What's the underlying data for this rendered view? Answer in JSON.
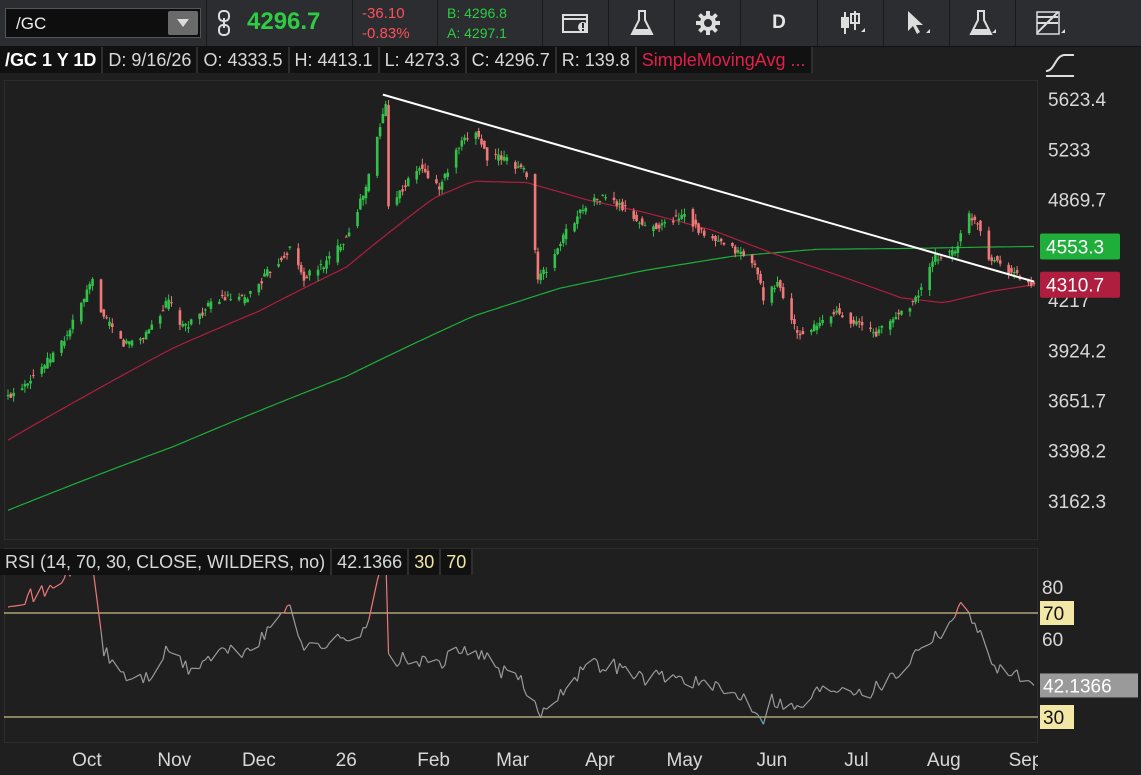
{
  "toolbar": {
    "symbol": "/GC",
    "last": "4296.7",
    "change": "-36.10",
    "change_pct": "-0.83%",
    "bid": "B: 4296.8",
    "ask": "A: 4297.1",
    "aggregation": "D"
  },
  "infobar": {
    "symbol_period": "/GC 1 Y 1D",
    "date": "D: 9/16/26",
    "open": "O: 4333.5",
    "high": "H: 4413.1",
    "low": "L: 4273.3",
    "close": "C: 4296.7",
    "range": "R: 139.8",
    "study": "SimpleMovingAvg ..."
  },
  "rsi_header": {
    "study": "RSI (14, 70, 30, CLOSE, WILDERS, no)",
    "value": "42.1366",
    "lower": "30",
    "upper": "70"
  },
  "colors": {
    "up": "#31c24a",
    "down": "#f07878",
    "sma_short": "#b01e3f",
    "sma_long": "#1fae3a",
    "trendline": "#ffffff",
    "rsi_normal": "#9a9a9a",
    "rsi_overbought": "#f07878",
    "rsi_oversold": "#2ec4d8",
    "level_line": "#f3e7a6"
  },
  "chart_data": [
    {
      "type": "candlestick",
      "ylim": [
        2990,
        5780
      ],
      "y_ticks": [
        "5623.4",
        "5233",
        "4869.7",
        "4217",
        "3924.2",
        "3651.7",
        "3398.2",
        "3162.3"
      ],
      "x_labels": [
        "Oct",
        "Nov",
        "Dec",
        "26",
        "Feb",
        "Mar",
        "Apr",
        "May",
        "Jun",
        "Jul",
        "Aug",
        "Sep"
      ],
      "price_badges": [
        {
          "value": "4553.3",
          "series": "sma_long"
        },
        {
          "value": "4310.7",
          "series": "sma_short"
        }
      ],
      "anchors": [
        [
          "2025-09-17",
          3670
        ],
        [
          "2025-09-24",
          3760
        ],
        [
          "2025-10-01",
          3860
        ],
        [
          "2025-10-08",
          4010
        ],
        [
          "2025-10-17",
          4330
        ],
        [
          "2025-10-21",
          4110
        ],
        [
          "2025-10-28",
          3960
        ],
        [
          "2025-11-04",
          4000
        ],
        [
          "2025-11-13",
          4210
        ],
        [
          "2025-11-18",
          4050
        ],
        [
          "2025-12-01",
          4230
        ],
        [
          "2025-12-10",
          4220
        ],
        [
          "2025-12-26",
          4540
        ],
        [
          "2025-12-31",
          4350
        ],
        [
          "2026-01-08",
          4450
        ],
        [
          "2026-01-15",
          4620
        ],
        [
          "2026-01-22",
          4950
        ],
        [
          "2026-01-28",
          5500
        ],
        [
          "2026-01-29",
          5580
        ],
        [
          "2026-01-30",
          4850
        ],
        [
          "2026-02-03",
          4920
        ],
        [
          "2026-02-10",
          5100
        ],
        [
          "2026-02-17",
          4950
        ],
        [
          "2026-02-24",
          5250
        ],
        [
          "2026-03-02",
          5380
        ],
        [
          "2026-03-06",
          5180
        ],
        [
          "2026-03-13",
          5160
        ],
        [
          "2026-03-20",
          5060
        ],
        [
          "2026-03-24",
          4350
        ],
        [
          "2026-03-27",
          4400
        ],
        [
          "2026-04-03",
          4650
        ],
        [
          "2026-04-10",
          4840
        ],
        [
          "2026-04-17",
          4890
        ],
        [
          "2026-04-24",
          4800
        ],
        [
          "2026-05-01",
          4680
        ],
        [
          "2026-05-08",
          4700
        ],
        [
          "2026-05-15",
          4780
        ],
        [
          "2026-05-22",
          4620
        ],
        [
          "2026-05-29",
          4560
        ],
        [
          "2026-06-05",
          4500
        ],
        [
          "2026-06-10",
          4400
        ],
        [
          "2026-06-12",
          4200
        ],
        [
          "2026-06-17",
          4330
        ],
        [
          "2026-06-24",
          4010
        ],
        [
          "2026-07-01",
          4060
        ],
        [
          "2026-07-08",
          4150
        ],
        [
          "2026-07-15",
          4080
        ],
        [
          "2026-07-22",
          4020
        ],
        [
          "2026-07-29",
          4120
        ],
        [
          "2026-08-05",
          4220
        ],
        [
          "2026-08-12",
          4480
        ],
        [
          "2026-08-19",
          4530
        ],
        [
          "2026-08-24",
          4760
        ],
        [
          "2026-08-27",
          4720
        ],
        [
          "2026-08-31",
          4490
        ],
        [
          "2026-09-03",
          4460
        ],
        [
          "2026-09-09",
          4380
        ],
        [
          "2026-09-16",
          4297
        ]
      ],
      "sma_short": [
        [
          "2025-09-17",
          3450
        ],
        [
          "2025-10-15",
          3680
        ],
        [
          "2025-11-15",
          3940
        ],
        [
          "2025-12-15",
          4150
        ],
        [
          "2026-01-15",
          4420
        ],
        [
          "2026-02-15",
          4880
        ],
        [
          "2026-03-01",
          5000
        ],
        [
          "2026-03-20",
          4990
        ],
        [
          "2026-04-10",
          4870
        ],
        [
          "2026-05-01",
          4780
        ],
        [
          "2026-05-25",
          4660
        ],
        [
          "2026-06-15",
          4510
        ],
        [
          "2026-07-10",
          4360
        ],
        [
          "2026-07-31",
          4230
        ],
        [
          "2026-08-15",
          4200
        ],
        [
          "2026-09-01",
          4270
        ],
        [
          "2026-09-16",
          4310.7
        ]
      ],
      "sma_long": [
        [
          "2025-09-17",
          3120
        ],
        [
          "2025-11-15",
          3420
        ],
        [
          "2026-01-15",
          3780
        ],
        [
          "2026-03-01",
          4120
        ],
        [
          "2026-04-01",
          4290
        ],
        [
          "2026-05-01",
          4400
        ],
        [
          "2026-06-01",
          4490
        ],
        [
          "2026-07-01",
          4535
        ],
        [
          "2026-08-01",
          4540
        ],
        [
          "2026-09-01",
          4550
        ],
        [
          "2026-09-16",
          4553.3
        ]
      ],
      "trendline": [
        [
          "2026-01-28",
          5660
        ],
        [
          "2026-09-16",
          4330
        ]
      ]
    },
    {
      "type": "line",
      "title": "RSI (14, 70, 30, CLOSE, WILDERS, no)",
      "ylim": [
        20,
        95
      ],
      "y_ticks": [
        "80",
        "60"
      ],
      "levels": [
        70,
        30
      ],
      "last_value": "42.1366",
      "anchors": [
        [
          "2025-09-17",
          75
        ],
        [
          "2025-10-01",
          78
        ],
        [
          "2025-10-10",
          88
        ],
        [
          "2025-10-17",
          88
        ],
        [
          "2025-10-21",
          55
        ],
        [
          "2025-10-29",
          45
        ],
        [
          "2025-11-06",
          45
        ],
        [
          "2025-11-13",
          56
        ],
        [
          "2025-11-20",
          48
        ],
        [
          "2025-12-01",
          55
        ],
        [
          "2025-12-10",
          55
        ],
        [
          "2025-12-18",
          62
        ],
        [
          "2025-12-26",
          75
        ],
        [
          "2025-12-31",
          56
        ],
        [
          "2026-01-07",
          58
        ],
        [
          "2026-01-15",
          60
        ],
        [
          "2026-01-22",
          65
        ],
        [
          "2026-01-29",
          92
        ],
        [
          "2026-01-30",
          52
        ],
        [
          "2026-02-05",
          52
        ],
        [
          "2026-02-15",
          50
        ],
        [
          "2026-02-25",
          55
        ],
        [
          "2026-03-02",
          56
        ],
        [
          "2026-03-10",
          48
        ],
        [
          "2026-03-17",
          45
        ],
        [
          "2026-03-24",
          32
        ],
        [
          "2026-03-26",
          32
        ],
        [
          "2026-04-01",
          40
        ],
        [
          "2026-04-10",
          50
        ],
        [
          "2026-04-20",
          50
        ],
        [
          "2026-04-30",
          45
        ],
        [
          "2026-05-08",
          46
        ],
        [
          "2026-05-18",
          44
        ],
        [
          "2026-05-28",
          40
        ],
        [
          "2026-06-05",
          38
        ],
        [
          "2026-06-12",
          30
        ],
        [
          "2026-06-15",
          37
        ],
        [
          "2026-06-24",
          33
        ],
        [
          "2026-07-01",
          40
        ],
        [
          "2026-07-10",
          42
        ],
        [
          "2026-07-20",
          40
        ],
        [
          "2026-07-31",
          48
        ],
        [
          "2026-08-07",
          58
        ],
        [
          "2026-08-14",
          63
        ],
        [
          "2026-08-21",
          72
        ],
        [
          "2026-08-26",
          68
        ],
        [
          "2026-08-31",
          52
        ],
        [
          "2026-09-05",
          48
        ],
        [
          "2026-09-12",
          45
        ],
        [
          "2026-09-16",
          42.1366
        ]
      ]
    }
  ]
}
